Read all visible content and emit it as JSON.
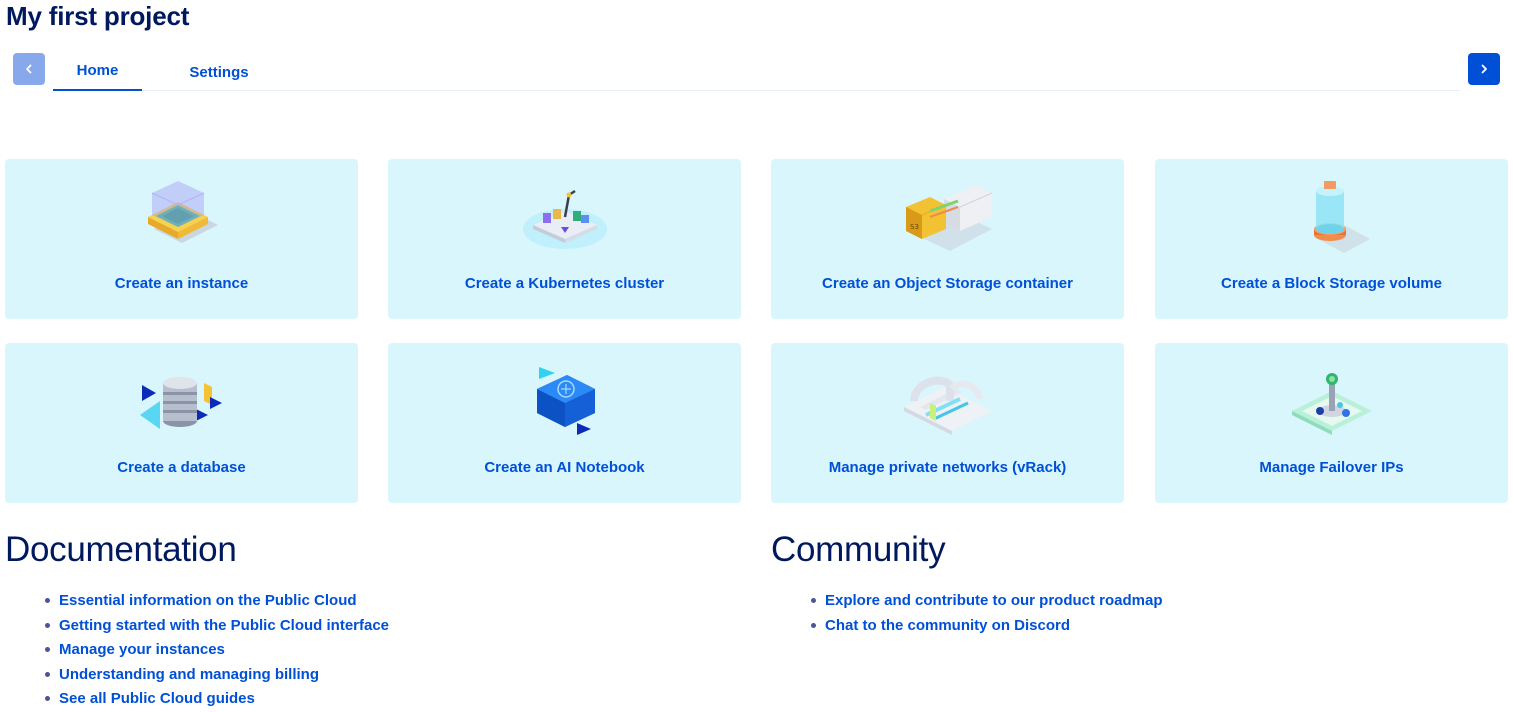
{
  "page": {
    "title": "My first project"
  },
  "tabs": [
    {
      "label": "Home",
      "active": true
    },
    {
      "label": "Settings",
      "active": false
    }
  ],
  "nav": {
    "prev_icon": "chevron-left-icon",
    "next_icon": "chevron-right-icon"
  },
  "colors": {
    "accent": "#0050d7",
    "card_bg": "#d9f6fd",
    "heading": "#00185e"
  },
  "cards": [
    {
      "label": "Create an instance",
      "icon": "instance-illustration"
    },
    {
      "label": "Create a Kubernetes cluster",
      "icon": "kubernetes-illustration"
    },
    {
      "label": "Create an Object Storage container",
      "icon": "object-storage-illustration"
    },
    {
      "label": "Create a Block Storage volume",
      "icon": "block-storage-illustration"
    },
    {
      "label": "Create a database",
      "icon": "database-illustration"
    },
    {
      "label": "Create an AI Notebook",
      "icon": "ai-notebook-illustration"
    },
    {
      "label": "Manage private networks (vRack)",
      "icon": "vrack-illustration"
    },
    {
      "label": "Manage Failover IPs",
      "icon": "failover-ip-illustration"
    }
  ],
  "documentation": {
    "heading": "Documentation",
    "links": [
      "Essential information on the Public Cloud",
      "Getting started with the Public Cloud interface",
      "Manage your instances",
      "Understanding and managing billing",
      "See all Public Cloud guides"
    ]
  },
  "community": {
    "heading": "Community",
    "links": [
      "Explore and contribute to our product roadmap",
      "Chat to the community on Discord"
    ]
  }
}
